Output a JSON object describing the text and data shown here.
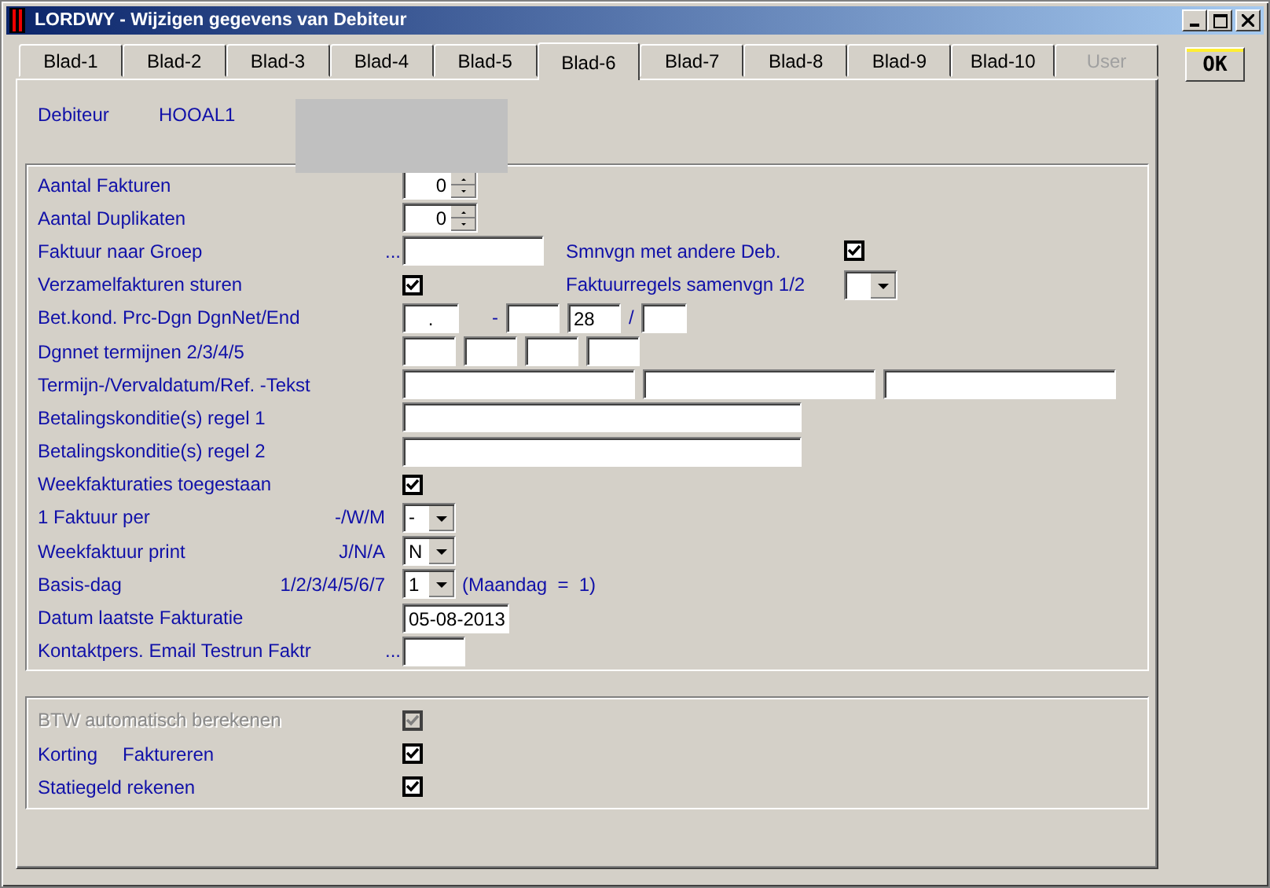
{
  "window": {
    "title": "LORDWY - Wijzigen gegevens van Debiteur"
  },
  "tabs": [
    {
      "label": "Blad-1",
      "selected": false,
      "disabled": false
    },
    {
      "label": "Blad-2",
      "selected": false,
      "disabled": false
    },
    {
      "label": "Blad-3",
      "selected": false,
      "disabled": false
    },
    {
      "label": "Blad-4",
      "selected": false,
      "disabled": false
    },
    {
      "label": "Blad-5",
      "selected": false,
      "disabled": false
    },
    {
      "label": "Blad-6",
      "selected": true,
      "disabled": false
    },
    {
      "label": "Blad-7",
      "selected": false,
      "disabled": false
    },
    {
      "label": "Blad-8",
      "selected": false,
      "disabled": false
    },
    {
      "label": "Blad-9",
      "selected": false,
      "disabled": false
    },
    {
      "label": "Blad-10",
      "selected": false,
      "disabled": false
    },
    {
      "label": "User",
      "selected": false,
      "disabled": true
    }
  ],
  "ok_button": "OK",
  "header": {
    "label": "Debiteur",
    "value": "HOOAL1"
  },
  "section1": [
    {
      "kind": "spinner",
      "label": "Aantal Fakturen",
      "value": "0"
    },
    {
      "kind": "spinner",
      "label": "Aantal Duplikaten",
      "value": "0"
    },
    {
      "kind": "lookup",
      "label": "Faktuur naar Groep",
      "dots": "...",
      "extra": {
        "kind": "checkbox",
        "label": "Smnvgn met andere Deb.",
        "checked": true
      }
    },
    {
      "kind": "checkbox",
      "label": "Verzamelfakturen sturen",
      "checked": true,
      "extra": {
        "kind": "select",
        "label": "Faktuurregels samenvgn 1/2"
      }
    },
    {
      "kind": "split",
      "label": "Bet.kond. Prc-Dgn DgnNet/End",
      "parts": [
        {
          "kind": "field",
          "value": "."
        },
        {
          "kind": "sep",
          "text": "-"
        },
        {
          "kind": "field"
        },
        {
          "kind": "field",
          "value": "28"
        },
        {
          "kind": "sep",
          "text": "/"
        },
        {
          "kind": "field"
        }
      ]
    },
    {
      "kind": "quad",
      "label": "Dgnnet termijnen 2/3/4/5",
      "parts": [
        {
          "kind": "field"
        },
        {
          "kind": "field"
        },
        {
          "kind": "field"
        },
        {
          "kind": "field"
        }
      ]
    },
    {
      "kind": "triple",
      "label": "Termijn-/Vervaldatum/Ref. -Tekst",
      "parts": [
        {
          "kind": "field"
        },
        {
          "kind": "field"
        },
        {
          "kind": "field"
        }
      ]
    },
    {
      "kind": "text",
      "label": "Betalingskonditie(s) regel 1"
    },
    {
      "kind": "text",
      "label": "Betalingskonditie(s) regel 2"
    },
    {
      "kind": "checkbox",
      "label": "Weekfakturaties toegestaan",
      "checked": true
    },
    {
      "kind": "select",
      "label": "1 Faktuur per",
      "hint": "-/W/M",
      "value": "-"
    },
    {
      "kind": "select",
      "label": "Weekfaktuur print",
      "hint": "J/N/A",
      "value": "N"
    },
    {
      "kind": "select",
      "label": "Basis-dag",
      "hint": "1/2/3/4/5/6/7",
      "value": "1",
      "note": "(Maandag  =  1)"
    },
    {
      "kind": "date",
      "label": "Datum laatste Fakturatie",
      "value": "05-08-2013"
    },
    {
      "kind": "code",
      "label": "Kontaktpers. Email Testrun Faktr",
      "dots": "..."
    }
  ],
  "section2": [
    {
      "label": "BTW automatisch berekenen",
      "checked": true,
      "disabled": true
    },
    {
      "label": "Korting",
      "label2": "Faktureren",
      "checked": true,
      "disabled": false
    },
    {
      "label": "Statiegeld rekenen",
      "checked": true,
      "disabled": false
    }
  ]
}
